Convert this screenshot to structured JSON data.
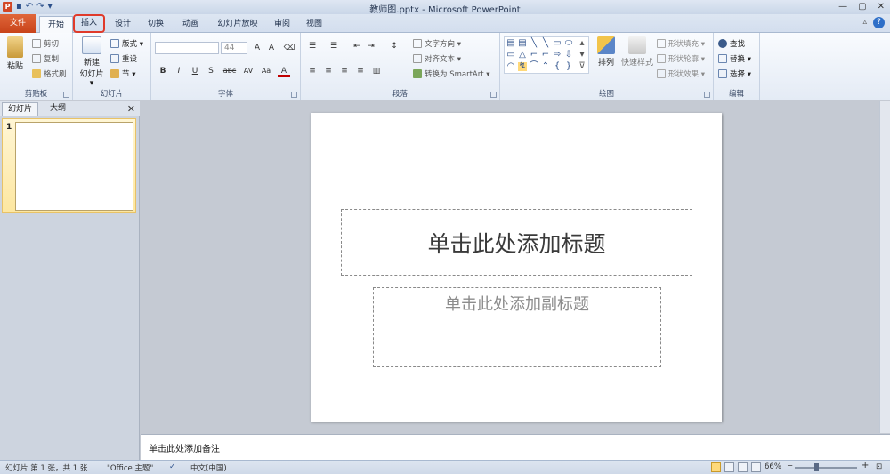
{
  "titlebar": {
    "app_icon": "P",
    "title": "教师图.pptx - Microsoft PowerPoint",
    "qat": [
      "save-icon",
      "undo-icon",
      "redo-icon",
      "customize-icon"
    ],
    "qat_glyphs": [
      "▪",
      "↶",
      "↷",
      "▾"
    ],
    "window_buttons": [
      "—",
      "▢",
      "✕"
    ]
  },
  "tabs": [
    "文件",
    "开始",
    "插入",
    "设计",
    "切换",
    "动画",
    "幻灯片放映",
    "审阅",
    "视图"
  ],
  "help": "?",
  "ribbon": {
    "clipboard": {
      "label": "剪贴板",
      "paste": "粘贴",
      "cut": "剪切",
      "copy": "复制",
      "format_painter": "格式刷"
    },
    "slides": {
      "label": "幻灯片",
      "new_slide": "新建",
      "new_slide_2": "幻灯片 ▾",
      "layout": "版式 ▾",
      "reset": "重设",
      "section": "节 ▾"
    },
    "font": {
      "label": "字体",
      "size": "44",
      "buttons": [
        "B",
        "I",
        "U",
        "S",
        "abc",
        "AV",
        "Aa",
        "A"
      ]
    },
    "paragraph": {
      "label": "段落",
      "text_direction": "文字方向 ▾",
      "align_text": "对齐文本 ▾",
      "smartart": "转换为 SmartArt ▾"
    },
    "drawing": {
      "label": "绘图",
      "arrange": "排列",
      "quick_styles": "快速样式",
      "shape_fill": "形状填充 ▾",
      "shape_outline": "形状轮廓 ▾",
      "shape_effects": "形状效果 ▾"
    },
    "editing": {
      "label": "编辑",
      "find": "查找",
      "replace": "替换 ▾",
      "select": "选择 ▾"
    }
  },
  "left_panel": {
    "tabs": [
      "幻灯片",
      "大纲"
    ],
    "close": "✕",
    "slide_number": "1"
  },
  "slide": {
    "title_placeholder": "单击此处添加标题",
    "subtitle_placeholder": "单击此处添加副标题"
  },
  "notes": {
    "placeholder": "单击此处添加备注"
  },
  "status": {
    "slide_info": "幻灯片 第 1 张，共 1 张",
    "theme": "\"Office 主题\"",
    "language": "中文(中国)",
    "zoom": "66%",
    "zoom_minus": "−",
    "zoom_plus": "+"
  },
  "colors": {
    "file_tab": "#d24726",
    "highlight": "#e03a2a",
    "accent": "#2b4f8a"
  }
}
